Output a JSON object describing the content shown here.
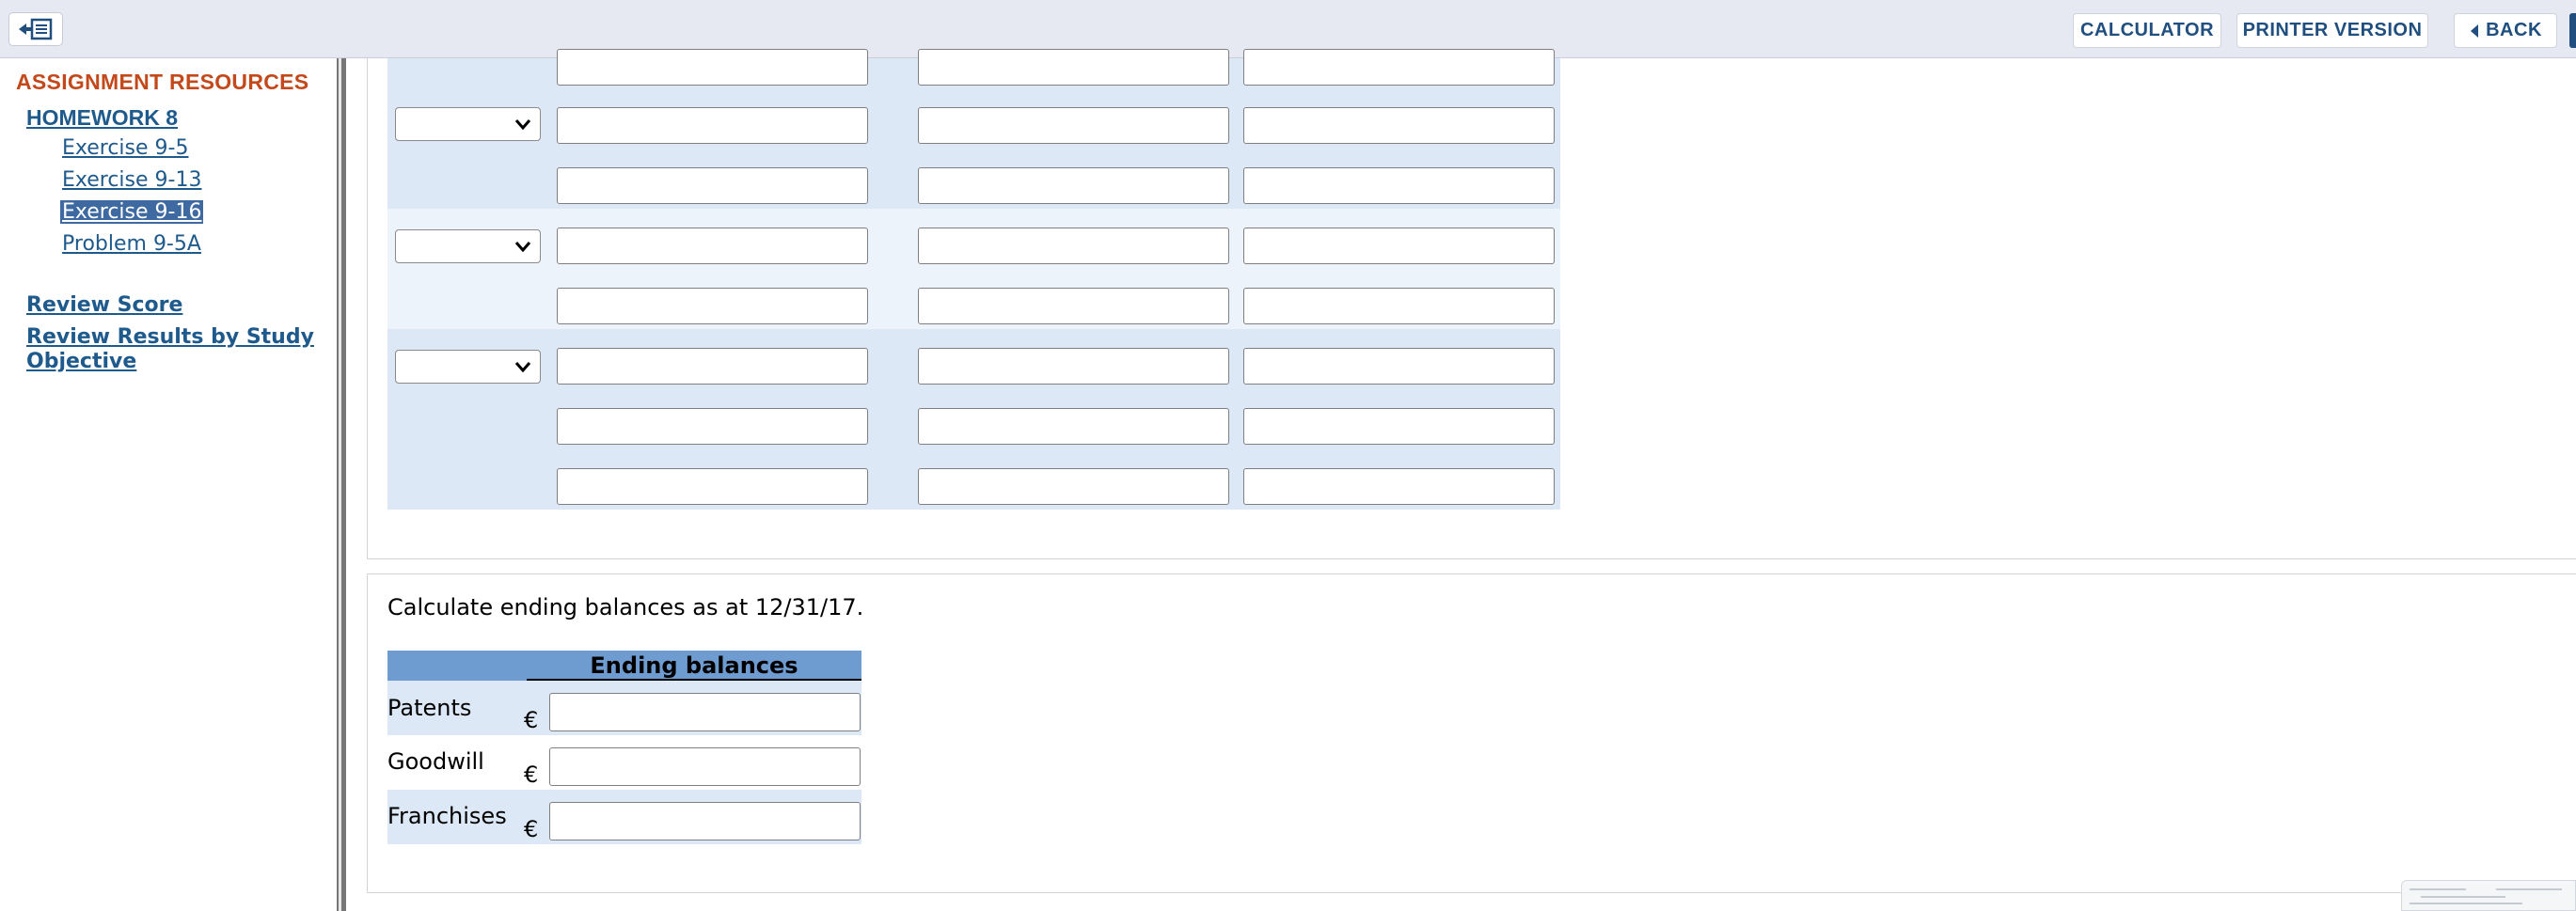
{
  "topbar": {
    "calculator_label": "CALCULATOR",
    "printer_label": "PRINTER VERSION",
    "back_label": "BACK"
  },
  "sidebar": {
    "title": "ASSIGNMENT RESOURCES",
    "homework": "HOMEWORK 8",
    "exercises": [
      {
        "label": "Exercise 9-5",
        "active": false
      },
      {
        "label": "Exercise 9-13",
        "active": false
      },
      {
        "label": "Exercise 9-16",
        "active": true
      },
      {
        "label": "Problem 9-5A",
        "active": false
      }
    ],
    "review_score": "Review Score",
    "review_results": "Review Results by Study Objective"
  },
  "journal": {
    "entries": [
      {
        "lines": 2,
        "partial_top": true
      },
      {
        "lines": 2
      },
      {
        "lines": 3
      }
    ],
    "colors": {
      "band_a": "#dce8f6",
      "band_b": "#edf3fb"
    }
  },
  "ending_balances": {
    "instruction": "Calculate ending balances as at 12/31/17.",
    "header": "Ending balances",
    "currency": "€",
    "rows": [
      {
        "label": "Patents",
        "value": ""
      },
      {
        "label": "Goodwill",
        "value": ""
      },
      {
        "label": "Franchises",
        "value": ""
      }
    ],
    "colors": {
      "header_bg": "#6e9bd0",
      "row_bg": "#dce8f6"
    }
  }
}
